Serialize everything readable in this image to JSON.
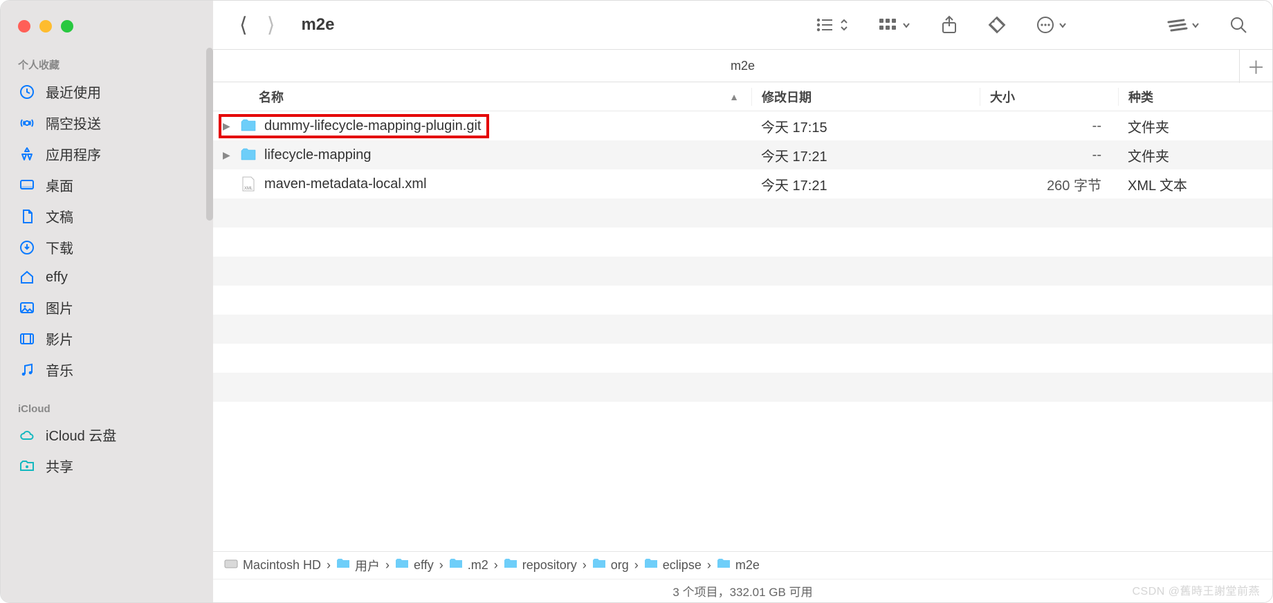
{
  "window_title": "m2e",
  "tab_title": "m2e",
  "sidebar": {
    "section_favorites": "个人收藏",
    "section_icloud": "iCloud",
    "items_fav": [
      {
        "label": "最近使用",
        "icon": "clock-icon"
      },
      {
        "label": "隔空投送",
        "icon": "airdrop-icon"
      },
      {
        "label": "应用程序",
        "icon": "apps-icon"
      },
      {
        "label": "桌面",
        "icon": "desktop-icon"
      },
      {
        "label": "文稿",
        "icon": "documents-icon"
      },
      {
        "label": "下载",
        "icon": "downloads-icon"
      },
      {
        "label": "effy",
        "icon": "home-icon"
      },
      {
        "label": "图片",
        "icon": "pictures-icon"
      },
      {
        "label": "影片",
        "icon": "movies-icon"
      },
      {
        "label": "音乐",
        "icon": "music-icon"
      }
    ],
    "items_icloud": [
      {
        "label": "iCloud 云盘",
        "icon": "cloud-icon"
      },
      {
        "label": "共享",
        "icon": "shared-folder-icon"
      }
    ]
  },
  "columns": {
    "name": "名称",
    "date": "修改日期",
    "size": "大小",
    "kind": "种类"
  },
  "rows": [
    {
      "name": "dummy-lifecycle-mapping-plugin.git",
      "date": "今天 17:15",
      "size": "--",
      "kind": "文件夹",
      "folder": true,
      "highlight": true
    },
    {
      "name": "lifecycle-mapping",
      "date": "今天 17:21",
      "size": "--",
      "kind": "文件夹",
      "folder": true,
      "highlight": false
    },
    {
      "name": "maven-metadata-local.xml",
      "date": "今天 17:21",
      "size": "260 字节",
      "kind": "XML 文本",
      "folder": false,
      "highlight": false
    }
  ],
  "num_alt_rows": 8,
  "path": [
    {
      "label": "Macintosh HD",
      "icon": "disk"
    },
    {
      "label": "用户",
      "icon": "folder"
    },
    {
      "label": "effy",
      "icon": "folder"
    },
    {
      "label": ".m2",
      "icon": "folder"
    },
    {
      "label": "repository",
      "icon": "folder"
    },
    {
      "label": "org",
      "icon": "folder"
    },
    {
      "label": "eclipse",
      "icon": "folder"
    },
    {
      "label": "m2e",
      "icon": "folder"
    }
  ],
  "status": "3 个项目，332.01 GB 可用",
  "watermark": "CSDN @舊時王謝堂前燕"
}
